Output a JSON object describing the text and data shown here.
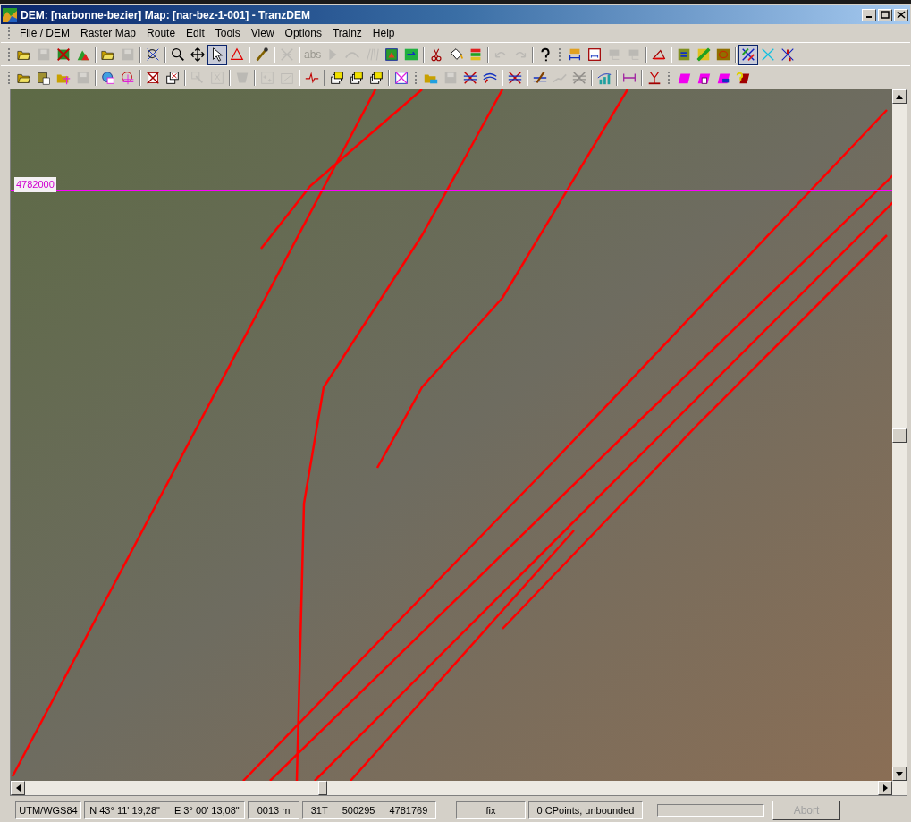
{
  "window": {
    "title": "DEM: [narbonne-bezier] Map: [nar-bez-1-001] - TranzDEM"
  },
  "menu": [
    "File / DEM",
    "Raster Map",
    "Route",
    "Edit",
    "Tools",
    "View",
    "Options",
    "Trainz",
    "Help"
  ],
  "toolbar_rows": [
    {
      "buttons": [
        {
          "disabled": false,
          "selected": false
        },
        {
          "disabled": true,
          "selected": false
        },
        {
          "disabled": false,
          "selected": false
        },
        {
          "disabled": false,
          "selected": false
        },
        {
          "disabled": false,
          "selected": false
        },
        {
          "disabled": true,
          "selected": false
        },
        {
          "disabled": false,
          "selected": false
        },
        {
          "disabled": false,
          "selected": false
        },
        {
          "disabled": false,
          "selected": false
        },
        {
          "disabled": false,
          "selected": true
        },
        {
          "disabled": false,
          "selected": false
        },
        {
          "disabled": false,
          "selected": false
        },
        {
          "disabled": true,
          "selected": false
        },
        {
          "disabled": true,
          "selected": false,
          "label": "abs"
        },
        {
          "disabled": true,
          "selected": false
        },
        {
          "disabled": true,
          "selected": false
        },
        {
          "disabled": true,
          "selected": false
        },
        {
          "disabled": false,
          "selected": false
        },
        {
          "disabled": false,
          "selected": false
        },
        {
          "disabled": false,
          "selected": false
        },
        {
          "disabled": false,
          "selected": false
        },
        {
          "disabled": false,
          "selected": false
        },
        {
          "disabled": true,
          "selected": false
        },
        {
          "disabled": true,
          "selected": false
        },
        {
          "disabled": false,
          "selected": false
        },
        {
          "disabled": false,
          "selected": false
        },
        {
          "disabled": false,
          "selected": false
        },
        {
          "disabled": true,
          "selected": false
        },
        {
          "disabled": true,
          "selected": false
        },
        {
          "disabled": false,
          "selected": false
        },
        {
          "disabled": false,
          "selected": false
        },
        {
          "disabled": false,
          "selected": false
        },
        {
          "disabled": false,
          "selected": false
        },
        {
          "disabled": false,
          "selected": true
        },
        {
          "disabled": false,
          "selected": false
        },
        {
          "disabled": false,
          "selected": false
        }
      ]
    },
    {
      "buttons": [
        {
          "disabled": false,
          "selected": false
        },
        {
          "disabled": false,
          "selected": false
        },
        {
          "disabled": false,
          "selected": false
        },
        {
          "disabled": true,
          "selected": false
        },
        {
          "disabled": false,
          "selected": false
        },
        {
          "disabled": false,
          "selected": false
        },
        {
          "disabled": false,
          "selected": false
        },
        {
          "disabled": false,
          "selected": false
        },
        {
          "disabled": true,
          "selected": false
        },
        {
          "disabled": true,
          "selected": false
        },
        {
          "disabled": true,
          "selected": false
        },
        {
          "disabled": true,
          "selected": false
        },
        {
          "disabled": true,
          "selected": false
        },
        {
          "disabled": false,
          "selected": false
        },
        {
          "disabled": false,
          "selected": false
        },
        {
          "disabled": false,
          "selected": false
        },
        {
          "disabled": false,
          "selected": false
        },
        {
          "disabled": false,
          "selected": false
        },
        {
          "disabled": false,
          "selected": false
        },
        {
          "disabled": true,
          "selected": false
        },
        {
          "disabled": false,
          "selected": false
        },
        {
          "disabled": false,
          "selected": false
        },
        {
          "disabled": false,
          "selected": false
        },
        {
          "disabled": false,
          "selected": false
        },
        {
          "disabled": true,
          "selected": false
        },
        {
          "disabled": true,
          "selected": false
        },
        {
          "disabled": false,
          "selected": false
        },
        {
          "disabled": false,
          "selected": false
        },
        {
          "disabled": false,
          "selected": false
        },
        {
          "disabled": false,
          "selected": false
        },
        {
          "disabled": false,
          "selected": false
        },
        {
          "disabled": false,
          "selected": false
        },
        {
          "disabled": false,
          "selected": false
        }
      ]
    }
  ],
  "map": {
    "grid_label": "4782000"
  },
  "status_bar": {
    "projection": "UTM/WGS84",
    "latitude": "N 43° 11' 19,28\"",
    "longitude": "E 3° 00' 13,08\"",
    "elevation": "0013 m",
    "utm_zone": "31T",
    "easting": "500295",
    "northing": "4781769",
    "mode": "fix",
    "cpoints": "0 CPoints, unbounded",
    "progress": {
      "level": 0
    },
    "abort": {
      "label": "Abort",
      "disabled": true
    }
  }
}
